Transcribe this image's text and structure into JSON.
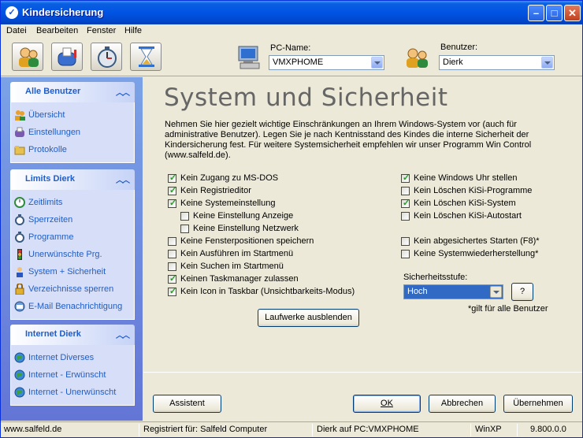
{
  "window": {
    "title": "Kindersicherung"
  },
  "menu": [
    "Datei",
    "Bearbeiten",
    "Fenster",
    "Hilfe"
  ],
  "toolbar": {
    "pc_name_label": "PC-Name:",
    "pc_name_value": "VMXPHOME",
    "user_label": "Benutzer:",
    "user_value": "Dierk"
  },
  "sidebar": {
    "groups": [
      {
        "title": "Alle Benutzer",
        "items": [
          "Übersicht",
          "Einstellungen",
          "Protokolle"
        ]
      },
      {
        "title": "Limits Dierk",
        "items": [
          "Zeitlimits",
          "Sperrzeiten",
          "Programme",
          "Unerwünschte Prg.",
          "System + Sicherheit",
          "Verzeichnisse sperren",
          "E-Mail Benachrichtigung"
        ]
      },
      {
        "title": "Internet Dierk",
        "items": [
          "Internet Diverses",
          "Internet - Erwünscht",
          "Internet - Unerwünscht"
        ]
      }
    ]
  },
  "main": {
    "headline": "System und Sicherheit",
    "description": "Nehmen Sie hier gezielt wichtige Einschränkungen an Ihrem Windows-System vor (auch für administrative Benutzer). Legen Sie je nach Kentnisstand des Kindes die interne Sicherheit der Kindersicherung fest. Für weitere Systemsicherheit empfehlen wir unser Programm Win Control (www.salfeld.de).",
    "left_options": [
      {
        "label": "Kein Zugang zu MS-DOS",
        "checked": true
      },
      {
        "label": "Kein Registrieditor",
        "checked": true
      },
      {
        "label": "Keine Systemeinstellung",
        "checked": true
      },
      {
        "label": "Keine Einstellung Anzeige",
        "checked": false
      },
      {
        "label": "Keine Einstellung Netzwerk",
        "checked": false
      },
      {
        "label": "Keine Fensterpositionen speichern",
        "checked": false
      },
      {
        "label": "Kein Ausführen im Startmenü",
        "checked": false
      },
      {
        "label": "Kein Suchen im Startmenü",
        "checked": false
      },
      {
        "label": "Keinen Taskmanager zulassen",
        "checked": true
      },
      {
        "label": "Kein Icon in Taskbar (Unsichtbarkeits-Modus)",
        "checked": true
      }
    ],
    "right_options": [
      {
        "label": "Keine Windows Uhr stellen",
        "checked": true
      },
      {
        "label": "Kein Löschen KiSi-Programme",
        "checked": false
      },
      {
        "label": "Kein Löschen KiSi-System",
        "checked": true
      },
      {
        "label": "Kein Löschen KiSi-Autostart",
        "checked": false
      },
      {
        "label": "Kein abgesichertes Starten (F8)*",
        "checked": false
      },
      {
        "label": "Keine Systemwiederherstellung*",
        "checked": false
      }
    ],
    "security_level_label": "Sicherheitsstufe:",
    "security_level_value": "Hoch",
    "help_button": "?",
    "footnote": "*gilt für alle Benutzer",
    "drives_button": "Laufwerke ausblenden",
    "assistant_button": "Assistent",
    "ok_button": "OK",
    "cancel_button": "Abbrechen",
    "apply_button": "Übernehmen"
  },
  "status": {
    "website": "www.salfeld.de",
    "registered": "Registriert für: Salfeld Computer",
    "user_pc": "Dierk auf PC:VMXPHOME",
    "os": "WinXP",
    "version": "9.800.0.0"
  }
}
